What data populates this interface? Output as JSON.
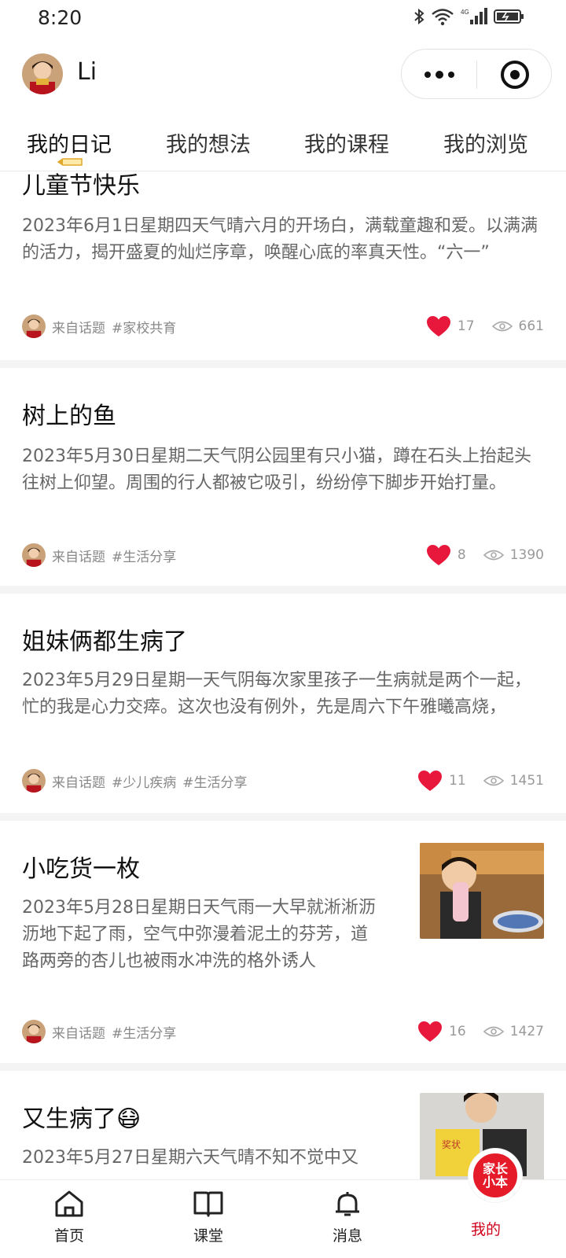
{
  "status_bar": {
    "time": "8:20",
    "network": "4G"
  },
  "header": {
    "user_name": "Li"
  },
  "tabs": [
    {
      "label": "我的日记",
      "active": true
    },
    {
      "label": "我的想法",
      "active": false
    },
    {
      "label": "我的课程",
      "active": false
    },
    {
      "label": "我的浏览",
      "active": false
    }
  ],
  "posts": [
    {
      "title": "儿童节快乐",
      "body": "2023年6月1日星期四天气晴六月的开场白，满载童趣和爱。以满满的活力，揭开盛夏的灿烂序章，唤醒心底的率真天性。“六一”",
      "source": "来自话题",
      "tags": [
        "#家校共育"
      ],
      "likes": "17",
      "views": "661"
    },
    {
      "title": "树上的鱼",
      "body": "2023年5月30日星期二天气阴公园里有只小猫，蹲在石头上抬起头往树上仰望。周围的行人都被它吸引，纷纷停下脚步开始打量。",
      "source": "来自话题",
      "tags": [
        "#生活分享"
      ],
      "likes": "8",
      "views": "1390"
    },
    {
      "title": "姐妹俩都生病了",
      "body": "2023年5月29日星期一天气阴每次家里孩子一生病就是两个一起，忙的我是心力交瘁。这次也没有例外，先是周六下午雅曦高烧，",
      "source": "来自话题",
      "tags": [
        "#少儿疾病",
        "#生活分享"
      ],
      "likes": "11",
      "views": "1451"
    },
    {
      "title": "小吃货一枚",
      "body": "2023年5月28日星期日天气雨一大早就淅淅沥沥地下起了雨，空气中弥漫着泥土的芬芳，道路两旁的杏儿也被雨水冲洗的格外诱人",
      "source": "来自话题",
      "tags": [
        "#生活分享"
      ],
      "likes": "16",
      "views": "1427"
    },
    {
      "title": "又生病了😷",
      "body": "2023年5月27日星期六天气晴不知不觉中又",
      "source": "",
      "tags": [],
      "likes": "",
      "views": ""
    }
  ],
  "tabbar": [
    {
      "label": "首页",
      "icon": "home-icon"
    },
    {
      "label": "课堂",
      "icon": "book-icon"
    },
    {
      "label": "消息",
      "icon": "bell-icon"
    },
    {
      "label": "我的",
      "icon": "profile-icon",
      "active": true
    }
  ],
  "brand_badge": "家长小本",
  "colors": {
    "accent": "#d0021b",
    "heart": "#e8183c",
    "divider": "#f4f4f4"
  }
}
